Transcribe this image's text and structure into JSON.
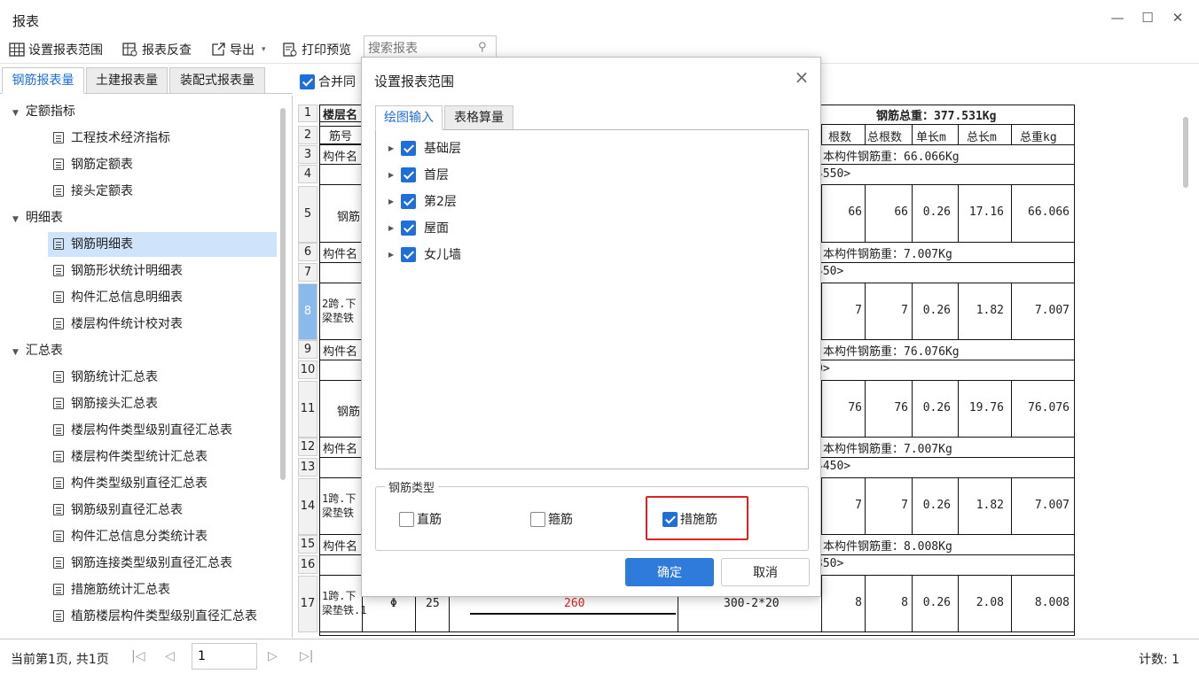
{
  "window": {
    "title": "报表"
  },
  "toolbar": {
    "set_range": "设置报表范围",
    "reverse_check": "报表反查",
    "export": "导出",
    "print_preview": "打印预览",
    "search_placeholder": "搜索报表"
  },
  "left_tabs": [
    "钢筋报表量",
    "土建报表量",
    "装配式报表量"
  ],
  "tree": {
    "groups": [
      {
        "label": "定额指标",
        "items": [
          "工程技术经济指标",
          "钢筋定额表",
          "接头定额表"
        ]
      },
      {
        "label": "明细表",
        "items": [
          "钢筋明细表",
          "钢筋形状统计明细表",
          "构件汇总信息明细表",
          "楼层构件统计校对表"
        ]
      },
      {
        "label": "汇总表",
        "items": [
          "钢筋统计汇总表",
          "钢筋接头汇总表",
          "楼层构件类型级别直径汇总表",
          "楼层构件类型统计汇总表",
          "构件类型级别直径汇总表",
          "钢筋级别直径汇总表",
          "构件汇总信息分类统计表",
          "钢筋连接类型级别直径汇总表",
          "措施筋统计汇总表",
          "植筋楼层构件类型级别直径汇总表"
        ]
      }
    ],
    "selected": "钢筋明细表"
  },
  "report": {
    "merge_label": "合并同",
    "row_numbers": [
      "1",
      "2",
      "3",
      "4",
      "5",
      "6",
      "7",
      "8",
      "9",
      "10",
      "11",
      "12",
      "13",
      "14",
      "15",
      "16",
      "17"
    ],
    "r1_left": "楼层名",
    "r1_total": "钢筋总重：377.531Kg",
    "headers": {
      "bar_no": "筋号",
      "count": "根数",
      "total_count": "总根数",
      "unit_len": "单长m",
      "total_len": "总长m",
      "total_wt": "总重kg"
    },
    "comp_name": "构件名",
    "bar_label": "钢筋",
    "span2_line1": "2跨.下",
    "span2_line2": "梁垫铁",
    "span1_line1": "1跨.下",
    "span1_line2": "梁垫铁",
    "span1_full2": "梁垫铁.1",
    "weights": [
      "本构件钢筋重：66.066Kg",
      "本构件钢筋重：7.007Kg",
      "本构件钢筋重：76.076Kg",
      "本构件钢筋重：7.007Kg",
      "本构件钢筋重：8.008Kg"
    ],
    "loc": [
      "4550>",
      "450>",
      "0>",
      "4450>",
      "350>"
    ],
    "data_rows": [
      {
        "c": "66",
        "tc": "66",
        "ul": "0.26",
        "tl": "17.16",
        "tw": "66.066"
      },
      {
        "c": "7",
        "tc": "7",
        "ul": "0.26",
        "tl": "1.82",
        "tw": "7.007"
      },
      {
        "c": "76",
        "tc": "76",
        "ul": "0.26",
        "tl": "19.76",
        "tw": "76.076"
      },
      {
        "c": "7",
        "tc": "7",
        "ul": "0.26",
        "tl": "1.82",
        "tw": "7.007"
      },
      {
        "c": "8",
        "tc": "8",
        "ul": "0.26",
        "tl": "2.08",
        "tw": "8.008"
      }
    ],
    "r17_grade": "Φ",
    "r17_dia": "25",
    "r17_shape": "260",
    "r17_formula": "300-2*20"
  },
  "dialog": {
    "title": "设置报表范围",
    "tabs": [
      "绘图输入",
      "表格算量"
    ],
    "floors": [
      "基础层",
      "首层",
      "第2层",
      "屋面",
      "女儿墙"
    ],
    "rebar_type_label": "钢筋类型",
    "rebar_types": [
      {
        "label": "直筋",
        "checked": false
      },
      {
        "label": "箍筋",
        "checked": false
      },
      {
        "label": "措施筋",
        "checked": true
      }
    ],
    "ok": "确定",
    "cancel": "取消"
  },
  "status": {
    "page_info": "当前第1页, 共1页",
    "page_value": "1",
    "count": "计数: 1"
  },
  "colors": {
    "accent": "#1e6fd9",
    "selected_bg": "#cfe4fb",
    "highlight": "#e02020",
    "shape_red": "#e02020"
  }
}
